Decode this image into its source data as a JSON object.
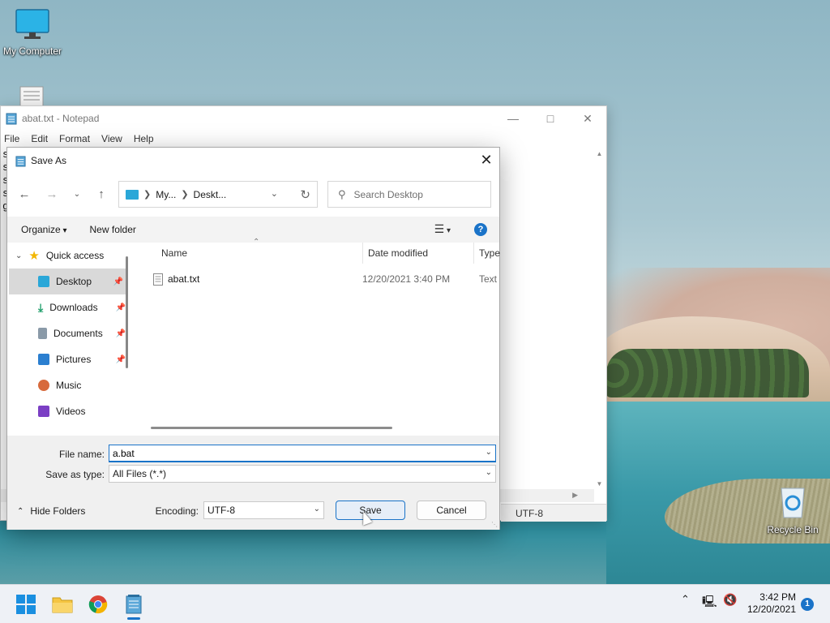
{
  "desktop": {
    "icons": [
      {
        "label": "My Computer",
        "icon": "monitor-icon"
      },
      {
        "label": "Recycle Bin",
        "icon": "recycle-bin-icon"
      }
    ]
  },
  "notepad": {
    "title": "abat.txt - Notepad",
    "menu": [
      "File",
      "Edit",
      "Format",
      "View",
      "Help"
    ],
    "text_lines": [
      "s",
      "s",
      "s",
      "s",
      "g"
    ],
    "status_encoding": "UTF-8"
  },
  "dialog": {
    "title": "Save As",
    "breadcrumb": [
      "My...",
      "Deskt..."
    ],
    "search_placeholder": "Search Desktop",
    "toolbar": {
      "organize": "Organize",
      "new_folder": "New folder",
      "help": "?"
    },
    "sidebar": [
      {
        "label": "Quick access",
        "icon": "star-icon",
        "color": "#f2b600"
      },
      {
        "label": "Desktop",
        "icon": "desktop-folder-icon",
        "color": "#2aa7d8",
        "pinned": true,
        "selected": true
      },
      {
        "label": "Downloads",
        "icon": "download-icon",
        "color": "#1e9e6a",
        "pinned": true
      },
      {
        "label": "Documents",
        "icon": "documents-icon",
        "color": "#8a9aa8",
        "pinned": true
      },
      {
        "label": "Pictures",
        "icon": "pictures-icon",
        "color": "#2b7fd0",
        "pinned": true
      },
      {
        "label": "Music",
        "icon": "music-icon",
        "color": "#d76a3c"
      },
      {
        "label": "Videos",
        "icon": "videos-icon",
        "color": "#7b3fc4"
      }
    ],
    "columns": [
      "Name",
      "Date modified",
      "Type"
    ],
    "files": [
      {
        "name": "abat.txt",
        "date": "12/20/2021 3:40 PM",
        "type": "Text Document"
      }
    ],
    "file_name_label": "File name:",
    "file_name_value": "a.bat",
    "save_type_label": "Save as type:",
    "save_type_value": "All Files  (*.*)",
    "hide_folders": "Hide Folders",
    "encoding_label": "Encoding:",
    "encoding_value": "UTF-8",
    "save_button": "Save",
    "cancel_button": "Cancel"
  },
  "taskbar": {
    "apps": [
      "start-icon",
      "file-explorer-icon",
      "chrome-icon",
      "notepad-icon"
    ],
    "time": "3:42 PM",
    "date": "12/20/2021",
    "notification_count": "1"
  },
  "colors": {
    "accent": "#1a73c8"
  }
}
